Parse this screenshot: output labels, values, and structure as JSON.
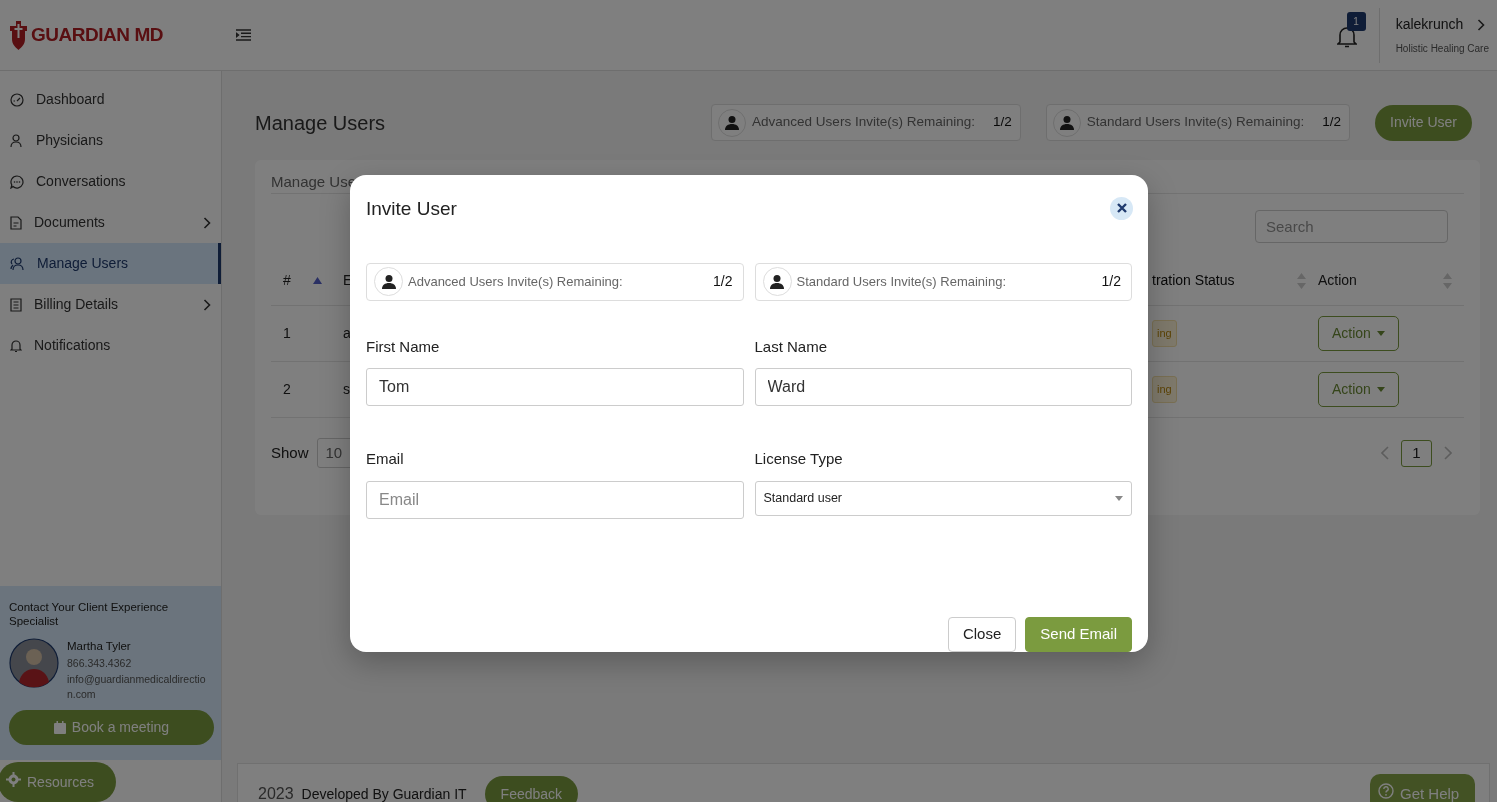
{
  "header": {
    "logo": "GUARDIAN MD",
    "notification_count": "1",
    "user": {
      "name": "kalekrunch",
      "org": "Holistic Healing Care"
    }
  },
  "sidebar": {
    "items": [
      {
        "label": "Dashboard",
        "selected": false,
        "has_submenu": false
      },
      {
        "label": "Physicians",
        "selected": false,
        "has_submenu": false
      },
      {
        "label": "Conversations",
        "selected": false,
        "has_submenu": false
      },
      {
        "label": "Documents",
        "selected": false,
        "has_submenu": true
      },
      {
        "label": "Manage Users",
        "selected": true,
        "has_submenu": false
      },
      {
        "label": "Billing Details",
        "selected": false,
        "has_submenu": true
      },
      {
        "label": "Notifications",
        "selected": false,
        "has_submenu": false
      }
    ],
    "contact": {
      "heading": "Contact Your Client Experience Specialist",
      "name": "Martha Tyler",
      "phone": "866.343.4362",
      "email": "info@guardianmedicaldirection.com",
      "button": "Book a meeting"
    },
    "resources_button": "Resources"
  },
  "page": {
    "title": "Manage Users",
    "quotas": [
      {
        "label": "Advanced Users Invite(s) Remaining:",
        "value": "1/2"
      },
      {
        "label": "Standard Users Invite(s) Remaining:",
        "value": "1/2"
      }
    ],
    "invite_button": "Invite User",
    "tab": "Manage Use",
    "search": {
      "placeholder": "Search"
    },
    "table": {
      "columns": [
        {
          "label": "#",
          "sorted": true
        },
        {
          "label": "E"
        },
        {
          "label": "tration Status",
          "sorted": false
        },
        {
          "label": "Action",
          "sorted": false
        }
      ],
      "rows": [
        {
          "number": "1",
          "email": "a",
          "status": "ing",
          "action": "Action"
        },
        {
          "number": "2",
          "email": "s",
          "status": "ing",
          "action": "Action"
        }
      ]
    },
    "show_label": "Show",
    "page_size": "10",
    "pagination": [
      {
        "label": "1",
        "selected": true
      }
    ]
  },
  "footer": {
    "year": "2023",
    "credit": "Developed By Guardian IT",
    "feedback_button": "Feedback"
  },
  "help_button": "Get Help",
  "modal": {
    "title": "Invite User",
    "quotas": [
      {
        "label": "Advanced Users Invite(s) Remaining:",
        "value": "1/2"
      },
      {
        "label": "Standard Users Invite(s) Remaining:",
        "value": "1/2"
      }
    ],
    "fields": [
      {
        "kind": "text",
        "label": "First Name",
        "value": "Tom"
      },
      {
        "kind": "text",
        "label": "Last Name",
        "value": "Ward"
      },
      {
        "kind": "text",
        "label": "Email",
        "placeholder": "Email"
      },
      {
        "kind": "select",
        "label": "License Type",
        "value": "Standard user"
      }
    ],
    "buttons": [
      {
        "kind": "secondary",
        "label": "Close"
      },
      {
        "kind": "primary",
        "label": "Send Email"
      }
    ]
  }
}
